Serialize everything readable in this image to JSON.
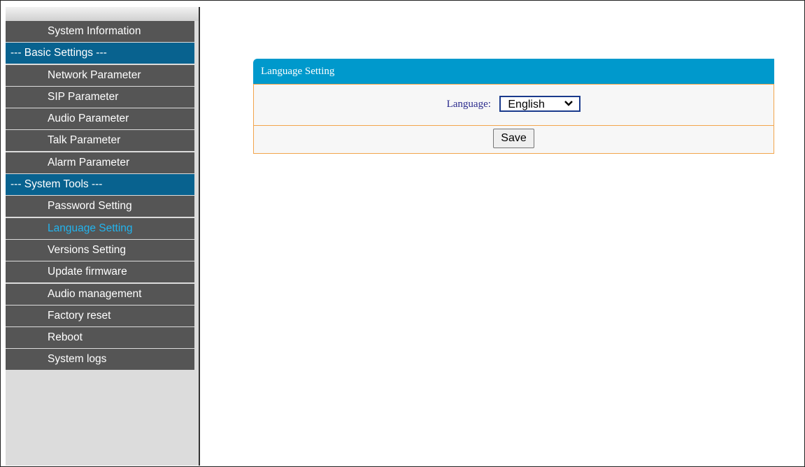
{
  "sidebar": {
    "items": [
      {
        "label": "System Information",
        "type": "item"
      },
      {
        "label": "--- Basic Settings ---",
        "type": "header"
      },
      {
        "label": "Network Parameter",
        "type": "item"
      },
      {
        "label": "SIP Parameter",
        "type": "item"
      },
      {
        "label": "Audio Parameter",
        "type": "item"
      },
      {
        "label": "Talk Parameter",
        "type": "item"
      },
      {
        "label": "Alarm Parameter",
        "type": "item"
      },
      {
        "label": "--- System Tools ---",
        "type": "header"
      },
      {
        "label": "Password Setting",
        "type": "item"
      },
      {
        "label": "Language Setting",
        "type": "item",
        "active": true
      },
      {
        "label": "Versions Setting",
        "type": "item"
      },
      {
        "label": "Update firmware",
        "type": "item"
      },
      {
        "label": "Audio management",
        "type": "item"
      },
      {
        "label": "Factory reset",
        "type": "item"
      },
      {
        "label": "Reboot",
        "type": "item"
      },
      {
        "label": "System logs",
        "type": "item"
      }
    ],
    "colors": {
      "item_bg": "#555555",
      "header_bg": "#08628f",
      "active_text": "#22b4ee"
    }
  },
  "panel": {
    "title": "Language Setting",
    "language_label": "Language:",
    "language_value": "English",
    "save_label": "Save",
    "header_color": "#0099cc",
    "border_color": "#f2a54c"
  },
  "icons": {
    "select_arrow": "chevron-down-icon"
  }
}
